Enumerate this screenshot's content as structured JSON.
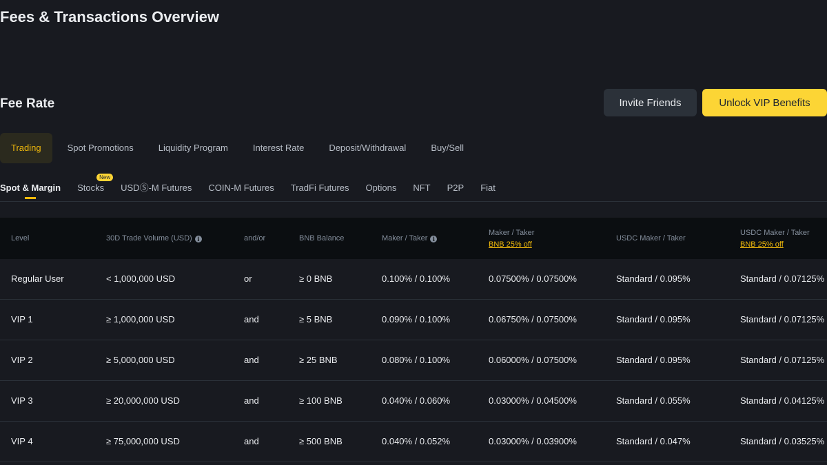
{
  "page": {
    "title": "Fees & Transactions Overview",
    "section_title": "Fee Rate"
  },
  "actions": {
    "invite_label": "Invite Friends",
    "vip_label": "Unlock VIP Benefits"
  },
  "main_tabs": [
    {
      "label": "Trading",
      "active": true
    },
    {
      "label": "Spot Promotions"
    },
    {
      "label": "Liquidity Program"
    },
    {
      "label": "Interest Rate"
    },
    {
      "label": "Deposit/Withdrawal"
    },
    {
      "label": "Buy/Sell"
    }
  ],
  "sub_tabs": [
    {
      "label": "Spot & Margin",
      "active": true
    },
    {
      "label": "Stocks",
      "badge": "New"
    },
    {
      "label": "USDⓈ-M Futures"
    },
    {
      "label": "COIN-M Futures"
    },
    {
      "label": "TradFi Futures"
    },
    {
      "label": "Options"
    },
    {
      "label": "NFT"
    },
    {
      "label": "P2P"
    },
    {
      "label": "Fiat"
    }
  ],
  "table": {
    "headers": [
      {
        "label": "Level"
      },
      {
        "label": "30D Trade Volume (USD)",
        "info": true
      },
      {
        "label": "and/or"
      },
      {
        "label": "BNB Balance"
      },
      {
        "label": "Maker / Taker",
        "info": true
      },
      {
        "label": "Maker / Taker",
        "sub": "BNB 25% off"
      },
      {
        "label": "USDC Maker / Taker"
      },
      {
        "label": "USDC Maker / Taker",
        "sub": "BNB 25% off"
      }
    ],
    "rows": [
      [
        "Regular User",
        "< 1,000,000 USD",
        "or",
        "≥ 0 BNB",
        "0.100% / 0.100%",
        "0.07500% / 0.07500%",
        "Standard / 0.095%",
        "Standard / 0.07125%"
      ],
      [
        "VIP 1",
        "≥ 1,000,000 USD",
        "and",
        "≥ 5 BNB",
        "0.090% / 0.100%",
        "0.06750% / 0.07500%",
        "Standard / 0.095%",
        "Standard / 0.07125%"
      ],
      [
        "VIP 2",
        "≥ 5,000,000 USD",
        "and",
        "≥ 25 BNB",
        "0.080% / 0.100%",
        "0.06000% / 0.07500%",
        "Standard / 0.095%",
        "Standard / 0.07125%"
      ],
      [
        "VIP 3",
        "≥ 20,000,000 USD",
        "and",
        "≥ 100 BNB",
        "0.040% / 0.060%",
        "0.03000% / 0.04500%",
        "Standard / 0.055%",
        "Standard / 0.04125%"
      ],
      [
        "VIP 4",
        "≥ 75,000,000 USD",
        "and",
        "≥ 500 BNB",
        "0.040% / 0.052%",
        "0.03000% / 0.03900%",
        "Standard / 0.047%",
        "Standard / 0.03525%"
      ]
    ]
  },
  "colors": {
    "background": "#181a20",
    "accent": "#f0b90b",
    "vip_button": "#fcd535",
    "secondary_button": "#2b3139"
  }
}
